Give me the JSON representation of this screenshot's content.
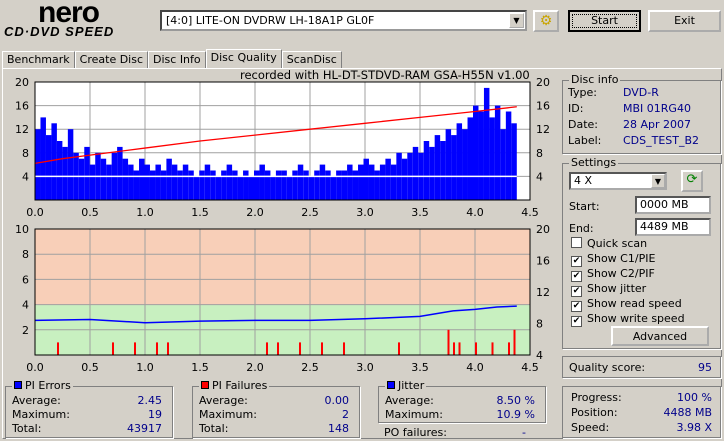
{
  "app": {
    "logo_line1": "nero",
    "logo_line2": "CD·DVD SPEED"
  },
  "toolbar": {
    "drive": "[4:0]  LITE-ON DVDRW LH-18A1P GL0F",
    "start_label": "Start",
    "exit_label": "Exit"
  },
  "tabs": [
    {
      "label": "Benchmark"
    },
    {
      "label": "Create Disc"
    },
    {
      "label": "Disc Info"
    },
    {
      "label": "Disc Quality"
    },
    {
      "label": "ScanDisc"
    }
  ],
  "recorded_with": "recorded with HL-DT-STDVD-RAM GSA-H55N v1.00",
  "disc_info": {
    "title": "Disc info",
    "type_label": "Type:",
    "type": "DVD-R",
    "id_label": "ID:",
    "id": "MBI 01RG40",
    "date_label": "Date:",
    "date": "28 Apr 2007",
    "label_label": "Label:",
    "label": "CDS_TEST_B2"
  },
  "settings": {
    "title": "Settings",
    "speed": "4 X",
    "start_label": "Start:",
    "start": "0000 MB",
    "end_label": "End:",
    "end": "4489 MB",
    "checks": [
      {
        "label": "Quick scan",
        "checked": false
      },
      {
        "label": "Show C1/PIE",
        "checked": true
      },
      {
        "label": "Show C2/PIF",
        "checked": true
      },
      {
        "label": "Show jitter",
        "checked": true
      },
      {
        "label": "Show read speed",
        "checked": true
      },
      {
        "label": "Show write speed",
        "checked": true
      }
    ],
    "advanced_label": "Advanced"
  },
  "quality": {
    "label": "Quality score:",
    "value": "95"
  },
  "progress": {
    "progress_label": "Progress:",
    "progress": "100 %",
    "position_label": "Position:",
    "position": "4488 MB",
    "speed_label": "Speed:",
    "speed": "3.98 X"
  },
  "pi_errors": {
    "title": "PI Errors",
    "color": "#0000ff",
    "average_label": "Average:",
    "average": "2.45",
    "maximum_label": "Maximum:",
    "maximum": "19",
    "total_label": "Total:",
    "total": "43917"
  },
  "pi_failures": {
    "title": "PI Failures",
    "color": "#ff0000",
    "average_label": "Average:",
    "average": "0.00",
    "maximum_label": "Maximum:",
    "maximum": "2",
    "total_label": "Total:",
    "total": "148"
  },
  "jitter": {
    "title": "Jitter",
    "color": "#0000ff",
    "average_label": "Average:",
    "average": "8.50 %",
    "maximum_label": "Maximum:",
    "maximum": "10.9 %",
    "po_label": "PO failures:",
    "po": "-"
  },
  "chart_data": [
    {
      "type": "bar",
      "title": "PI Errors / Read speed",
      "xlim": [
        0,
        4.5
      ],
      "ylim": [
        0,
        20
      ],
      "y2lim": [
        0,
        20
      ],
      "xticks": [
        "0.0",
        "0.5",
        "1.0",
        "1.5",
        "2.0",
        "2.5",
        "3.0",
        "3.5",
        "4.0",
        "4.5"
      ],
      "yticks": [
        "4",
        "8",
        "12",
        "16",
        "20"
      ],
      "y2ticks": [
        "4",
        "8",
        "12",
        "16",
        "20"
      ],
      "pi_errors": [
        12,
        14,
        11,
        13,
        10,
        9,
        12,
        8,
        7,
        9,
        6,
        8,
        7,
        6,
        8,
        9,
        7,
        6,
        5,
        7,
        6,
        5,
        6,
        5,
        7,
        6,
        5,
        6,
        5,
        4,
        5,
        6,
        5,
        4,
        5,
        6,
        5,
        4,
        5,
        4,
        5,
        6,
        5,
        4,
        5,
        5,
        4,
        5,
        6,
        5,
        4,
        5,
        6,
        5,
        4,
        5,
        5,
        6,
        5,
        6,
        7,
        6,
        5,
        6,
        7,
        6,
        8,
        7,
        8,
        9,
        8,
        10,
        9,
        11,
        10,
        12,
        11,
        13,
        12,
        14,
        16,
        15,
        19,
        14,
        16,
        12,
        15,
        13
      ],
      "read_speed": {
        "x": [
          0,
          0.25,
          0.5,
          1,
          1.5,
          2,
          2.5,
          3,
          3.5,
          4,
          4.38
        ],
        "y": [
          6.2,
          7,
          7.6,
          8.8,
          10,
          11,
          12,
          13,
          14,
          15,
          15.8
        ]
      },
      "write_speed": 4
    },
    {
      "type": "line",
      "title": "PI Failures / Jitter",
      "xlim": [
        0,
        4.5
      ],
      "ylim": [
        0,
        10
      ],
      "y2lim": [
        4,
        20
      ],
      "xticks": [
        "0.0",
        "0.5",
        "1.0",
        "1.5",
        "2.0",
        "2.5",
        "3.0",
        "3.5",
        "4.0",
        "4.5"
      ],
      "yticks": [
        "2",
        "4",
        "6",
        "8",
        "10"
      ],
      "y2ticks": [
        "4",
        "8",
        "12",
        "16",
        "20"
      ],
      "jitter": {
        "x": [
          0,
          0.5,
          1,
          1.5,
          2,
          2.5,
          3,
          3.5,
          3.8,
          4,
          4.2,
          4.38
        ],
        "y": [
          8.4,
          8.5,
          8.1,
          8.3,
          8.4,
          8.4,
          8.6,
          8.9,
          9.6,
          9.8,
          10.1,
          10.2
        ]
      },
      "pi_failures": {
        "x": [
          0.2,
          0.7,
          0.9,
          1.1,
          1.2,
          2.1,
          2.2,
          2.4,
          2.6,
          2.8,
          3.3,
          3.75,
          3.8,
          3.85,
          4.0,
          4.15,
          4.3,
          4.35
        ],
        "y": [
          1,
          1,
          1,
          1,
          1,
          1,
          1,
          1,
          1,
          1,
          1,
          2,
          1,
          1,
          1,
          1,
          1,
          2
        ]
      }
    }
  ]
}
